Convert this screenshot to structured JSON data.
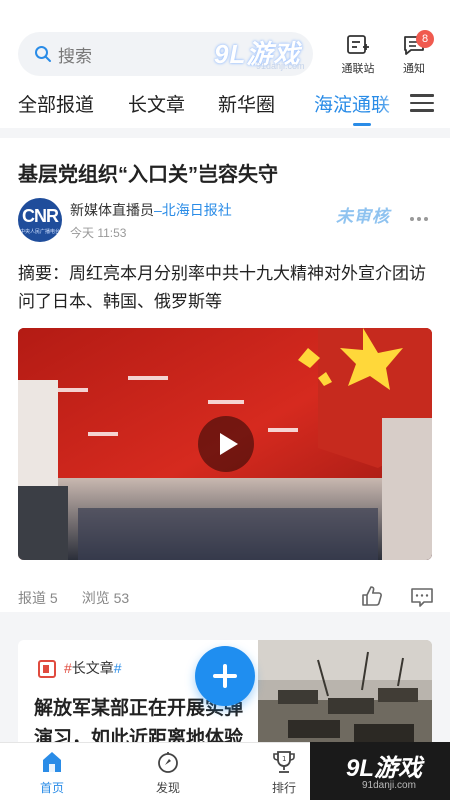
{
  "header": {
    "search_placeholder": "搜索",
    "watermark_text": "9L游戏",
    "watermark_url": "91danji.com",
    "tongliangzhan_label": "通联站",
    "notice_label": "通知",
    "notice_badge": "8"
  },
  "tabs": [
    {
      "label": "全部报道",
      "active": false
    },
    {
      "label": "长文章",
      "active": false
    },
    {
      "label": "新华圈",
      "active": false
    },
    {
      "label": "海淀通联",
      "active": true
    }
  ],
  "card1": {
    "title": "基层党组织“入口关”岂容失守",
    "avatar_text": "CNR",
    "avatar_subtext": "中央人民广播电台",
    "author": "新媒体直播员",
    "source": "–北海日报社",
    "time": "今天 11:53",
    "stamp": "未审核",
    "summary": "摘要：周红亮本月分别率中共十九大精神对外宣介团访问了日本、韩国、俄罗斯等",
    "reports": "报道 5",
    "views": "浏览 53"
  },
  "card2": {
    "tag_hash1": "#",
    "tag_label": "长文章",
    "tag_hash2": "#",
    "title": "解放军某部正在开展实弹演习，如此近距离地体验"
  },
  "bottom_nav": [
    {
      "label": "首页",
      "icon": "home-icon",
      "active": true
    },
    {
      "label": "发现",
      "icon": "discover-icon",
      "active": false
    },
    {
      "label": "排行",
      "icon": "trophy-icon",
      "active": false
    }
  ],
  "footer_watermark": {
    "text": "9L游戏",
    "url": "91danji.com"
  },
  "colors": {
    "accent": "#2a8ce7",
    "badge": "#f05a4f",
    "fab": "#1f8ef0"
  }
}
